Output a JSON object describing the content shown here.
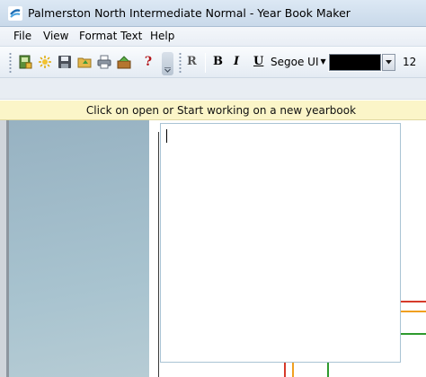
{
  "window": {
    "title": "Palmerston North Intermediate Normal - Year Book Maker"
  },
  "menu": [
    "File",
    "View",
    "Format Text",
    "Help"
  ],
  "toolbar": {
    "icons": [
      "new-book-icon",
      "new-star-icon",
      "save-icon",
      "open-folder-icon",
      "print-icon",
      "export-icon",
      "help-icon"
    ],
    "help_glyph": "?",
    "format": {
      "regular": "R",
      "bold": "B",
      "italic": "I",
      "underline": "U"
    },
    "font_name": "Segoe UI",
    "font_color": "#000000",
    "font_size": "12"
  },
  "status": {
    "message": "Click on open or Start working on a new yearbook"
  },
  "colors": {
    "status_bg": "#fbf5c8",
    "red": "#d63a2a",
    "orange": "#f0a020",
    "green": "#2e9a2e"
  }
}
